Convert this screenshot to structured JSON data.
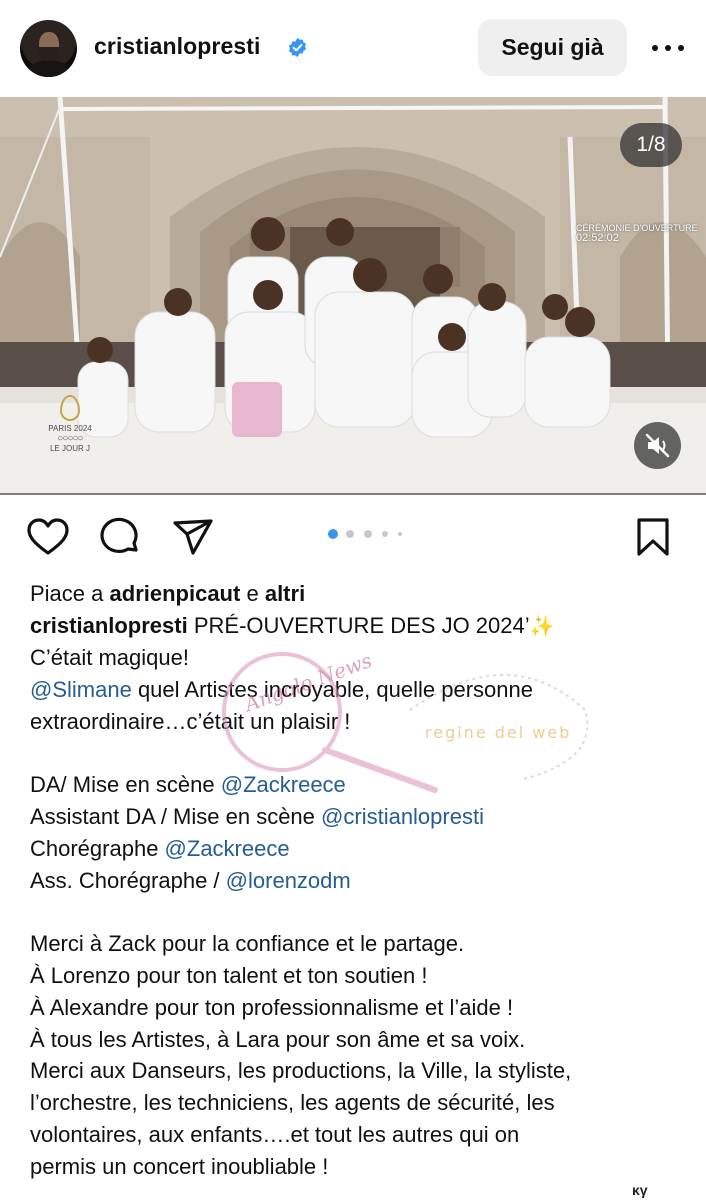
{
  "post": {
    "username": "cristianlopresti",
    "verified": true,
    "follow_label": "Segui già",
    "more_icon": "more-horizontal-icon"
  },
  "media": {
    "counter": "1/8",
    "broadcast_title": "CÉRÉMONIE D'OUVERTURE",
    "broadcast_time": "02:52:02",
    "event_logo_line1": "PARIS 2024",
    "event_logo_line2": "LE JOUR J",
    "sound_state": "muted",
    "current_slide": 1,
    "visible_dots": 5
  },
  "actions": {
    "like_icon": "heart-icon",
    "comment_icon": "comment-icon",
    "share_icon": "send-icon",
    "save_icon": "bookmark-icon"
  },
  "likes": {
    "prefix": "Piace a",
    "user": "adrienpicaut",
    "joiner": "e",
    "others": "altri"
  },
  "caption": {
    "author": "cristianlopresti",
    "title": " PRÉ-OUVERTURE DES JO 2024’",
    "sparkle": "✨",
    "line2": "C’était magique!",
    "mention_slimane": "@Slimane",
    "line3_rest": " quel Artistes incroyable, quelle personne",
    "line4": "extraordinaire…c’était un plaisir !",
    "credits": [
      {
        "label": "DA/ Mise en scène ",
        "mention": "@Zackreece"
      },
      {
        "label": "Assistant DA / Mise en scène ",
        "mention": "@cristianlopresti"
      },
      {
        "label": "Chorégraphe ",
        "mention": "@Zackreece"
      },
      {
        "label": "Ass. Chorégraphe / ",
        "mention": "@lorenzodm"
      }
    ],
    "thanks": [
      "Merci à Zack pour la confiance et le partage.",
      "À Lorenzo pour ton talent et ton soutien !",
      "À Alexandre pour ton professionnalisme et l’aide !",
      "À tous les Artistes, à Lara  pour son âme et sa voix."
    ],
    "closing": [
      "Merci aux Danseurs, les productions, la Ville, la styliste,",
      "l’orchestre, les techniciens, les agents de sécurité, les",
      "volontaires, aux enfants….et tout les autres qui on",
      "permis un concert inoubliable !"
    ]
  },
  "watermark": {
    "text1": "Angolo News",
    "text2": "regine del web"
  },
  "corner_mark": "κγ"
}
